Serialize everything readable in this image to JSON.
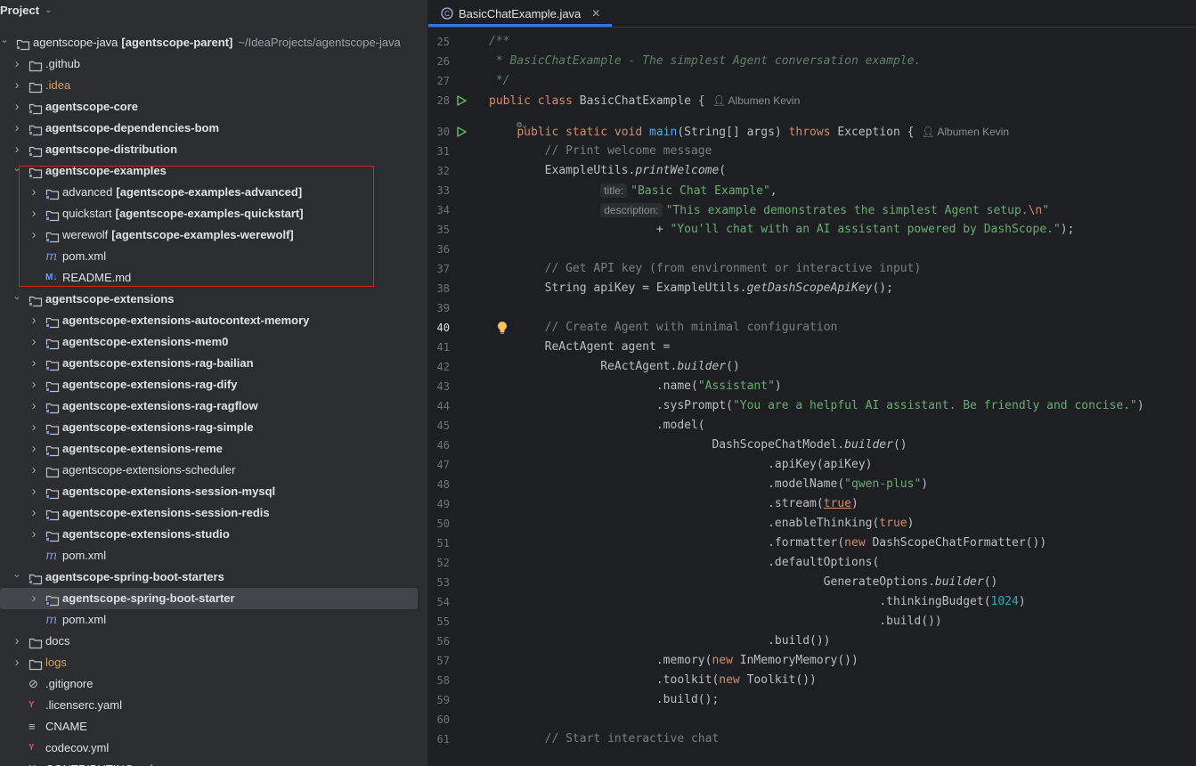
{
  "project_panel": {
    "title": "Project",
    "tree": [
      {
        "label": "agentscope-java",
        "suffix_bold": "[agentscope-parent]",
        "path": "~/IdeaProjects/agentscope-java",
        "icon": "module-folder-icon",
        "arrow": "expanded",
        "indent": 0
      },
      {
        "label": ".github",
        "icon": "folder-icon",
        "arrow": "collapsed",
        "indent": 1
      },
      {
        "label": ".idea",
        "icon": "folder-icon",
        "arrow": "collapsed",
        "indent": 1,
        "color": "orange"
      },
      {
        "label": "agentscope-core",
        "icon": "module-folder-icon",
        "arrow": "collapsed",
        "indent": 1,
        "bold": true
      },
      {
        "label": "agentscope-dependencies-bom",
        "icon": "module-folder-icon",
        "arrow": "collapsed",
        "indent": 1,
        "bold": true
      },
      {
        "label": "agentscope-distribution",
        "icon": "module-folder-icon",
        "arrow": "collapsed",
        "indent": 1,
        "bold": true
      },
      {
        "label": "agentscope-examples",
        "icon": "module-folder-icon",
        "arrow": "expanded",
        "indent": 1,
        "bold": true
      },
      {
        "label": "advanced",
        "suffix_bold": "[agentscope-examples-advanced]",
        "icon": "module-folder-icon",
        "arrow": "collapsed",
        "indent": 2
      },
      {
        "label": "quickstart",
        "suffix_bold": "[agentscope-examples-quickstart]",
        "icon": "module-folder-icon",
        "arrow": "collapsed",
        "indent": 2
      },
      {
        "label": "werewolf",
        "suffix_bold": "[agentscope-examples-werewolf]",
        "icon": "module-folder-icon",
        "arrow": "collapsed",
        "indent": 2
      },
      {
        "label": "pom.xml",
        "icon": "maven-icon",
        "arrow": "none",
        "indent": 2
      },
      {
        "label": "README.md",
        "icon": "markdown-icon",
        "arrow": "none",
        "indent": 2
      },
      {
        "label": "agentscope-extensions",
        "icon": "module-folder-icon",
        "arrow": "expanded",
        "indent": 1,
        "bold": true
      },
      {
        "label": "agentscope-extensions-autocontext-memory",
        "icon": "module-folder-icon",
        "arrow": "collapsed",
        "indent": 2,
        "bold": true
      },
      {
        "label": "agentscope-extensions-mem0",
        "icon": "module-folder-icon",
        "arrow": "collapsed",
        "indent": 2,
        "bold": true
      },
      {
        "label": "agentscope-extensions-rag-bailian",
        "icon": "module-folder-icon",
        "arrow": "collapsed",
        "indent": 2,
        "bold": true
      },
      {
        "label": "agentscope-extensions-rag-dify",
        "icon": "module-folder-icon",
        "arrow": "collapsed",
        "indent": 2,
        "bold": true
      },
      {
        "label": "agentscope-extensions-rag-ragflow",
        "icon": "module-folder-icon",
        "arrow": "collapsed",
        "indent": 2,
        "bold": true
      },
      {
        "label": "agentscope-extensions-rag-simple",
        "icon": "module-folder-icon",
        "arrow": "collapsed",
        "indent": 2,
        "bold": true
      },
      {
        "label": "agentscope-extensions-reme",
        "icon": "module-folder-icon",
        "arrow": "collapsed",
        "indent": 2,
        "bold": true
      },
      {
        "label": "agentscope-extensions-scheduler",
        "icon": "folder-icon",
        "arrow": "collapsed",
        "indent": 2
      },
      {
        "label": "agentscope-extensions-session-mysql",
        "icon": "module-folder-icon",
        "arrow": "collapsed",
        "indent": 2,
        "bold": true
      },
      {
        "label": "agentscope-extensions-session-redis",
        "icon": "module-folder-icon",
        "arrow": "collapsed",
        "indent": 2,
        "bold": true
      },
      {
        "label": "agentscope-extensions-studio",
        "icon": "module-folder-icon",
        "arrow": "collapsed",
        "indent": 2,
        "bold": true
      },
      {
        "label": "pom.xml",
        "icon": "maven-icon",
        "arrow": "none",
        "indent": 2
      },
      {
        "label": "agentscope-spring-boot-starters",
        "icon": "module-folder-icon",
        "arrow": "expanded",
        "indent": 1,
        "bold": true
      },
      {
        "label": "agentscope-spring-boot-starter",
        "icon": "module-folder-icon",
        "arrow": "collapsed",
        "indent": 2,
        "bold": true,
        "selected": true
      },
      {
        "label": "pom.xml",
        "icon": "maven-icon",
        "arrow": "none",
        "indent": 2
      },
      {
        "label": "docs",
        "icon": "folder-icon",
        "arrow": "collapsed",
        "indent": 1
      },
      {
        "label": "logs",
        "icon": "folder-icon",
        "arrow": "collapsed",
        "indent": 1,
        "color": "orange"
      },
      {
        "label": ".gitignore",
        "icon": "gitignore-icon",
        "arrow": "none",
        "indent": 1
      },
      {
        "label": ".licenserc.yaml",
        "icon": "yaml-icon",
        "arrow": "none",
        "indent": 1
      },
      {
        "label": "CNAME",
        "icon": "text-file-icon",
        "arrow": "none",
        "indent": 1
      },
      {
        "label": "codecov.yml",
        "icon": "yaml-icon",
        "arrow": "none",
        "indent": 1
      },
      {
        "label": "CONTRIBUTING.md",
        "icon": "markdown-icon",
        "arrow": "none",
        "indent": 1
      }
    ]
  },
  "editor": {
    "tab_label": "BasicChatExample.java",
    "tab_close": "✕",
    "author": "Albumen Kevin",
    "current_line": 40,
    "lines": [
      {
        "n": 25,
        "html": "<span class=\"c-doc\">/**</span>"
      },
      {
        "n": 26,
        "html": "<span class=\"c-doc\"> * BasicChatExample - The simplest Agent conversation example.</span>"
      },
      {
        "n": 27,
        "html": "<span class=\"c-doc\"> */</span>"
      },
      {
        "n": 28,
        "html": "<span class=\"c-kw\">public class </span>BasicChatExample {",
        "author": true,
        "run": true
      },
      {
        "n": 30,
        "html": "    <span class=\"c-kw\">public static void </span><span class=\"c-fn\">main</span>(String[] args) <span class=\"c-kw\">throws </span>Exception {",
        "author": true,
        "run": true
      },
      {
        "n": 31,
        "html": "        <span class=\"c-com\">// Print welcome message</span>"
      },
      {
        "n": 32,
        "html": "        ExampleUtils.<span class=\"c-it\">printWelcome</span>("
      },
      {
        "n": 33,
        "html": "                <span class=\"inlay\">title:</span><span class=\"c-str\">\"Basic Chat Example\"</span>,"
      },
      {
        "n": 34,
        "html": "                <span class=\"inlay\">description:</span><span class=\"c-str\">\"This example demonstrates the simplest Agent setup.</span><span class=\"c-esc\">\\n</span><span class=\"c-str\">\"</span>"
      },
      {
        "n": 35,
        "html": "                        + <span class=\"c-str\">\"You'll chat with an AI assistant powered by DashScope.\"</span>);"
      },
      {
        "n": 36,
        "html": ""
      },
      {
        "n": 37,
        "html": "        <span class=\"c-com\">// Get API key (from environment or interactive input)</span>"
      },
      {
        "n": 38,
        "html": "        String apiKey = ExampleUtils.<span class=\"c-it\">getDashScopeApiKey</span>();"
      },
      {
        "n": 39,
        "html": ""
      },
      {
        "n": 40,
        "html": "        <span class=\"c-com\">// Create Agent with minimal configuration</span>",
        "bulb": true
      },
      {
        "n": 41,
        "html": "        ReActAgent agent ="
      },
      {
        "n": 42,
        "html": "                ReActAgent.<span class=\"c-it\">builder</span>()"
      },
      {
        "n": 43,
        "html": "                        .name(<span class=\"c-str\">\"Assistant\"</span>)"
      },
      {
        "n": 44,
        "html": "                        .sysPrompt(<span class=\"c-str\">\"You are a helpful AI assistant. Be friendly and concise.\"</span>)"
      },
      {
        "n": 45,
        "html": "                        .model("
      },
      {
        "n": 46,
        "html": "                                DashScopeChatModel.<span class=\"c-it\">builder</span>()"
      },
      {
        "n": 47,
        "html": "                                        .apiKey(apiKey)"
      },
      {
        "n": 48,
        "html": "                                        .modelName(<span class=\"c-str\">\"qwen-plus\"</span>)"
      },
      {
        "n": 49,
        "html": "                                        .stream(<span class=\"c-kw c-under\">true</span>)"
      },
      {
        "n": 50,
        "html": "                                        .enableThinking(<span class=\"c-kw\">true</span>)"
      },
      {
        "n": 51,
        "html": "                                        .formatter(<span class=\"c-kw\">new </span>DashScopeChatFormatter())"
      },
      {
        "n": 52,
        "html": "                                        .defaultOptions("
      },
      {
        "n": 53,
        "html": "                                                GenerateOptions.<span class=\"c-it\">builder</span>()"
      },
      {
        "n": 54,
        "html": "                                                        .thinkingBudget(<span class=\"c-num\">1024</span>)"
      },
      {
        "n": 55,
        "html": "                                                        .build())"
      },
      {
        "n": 56,
        "html": "                                        .build())"
      },
      {
        "n": 57,
        "html": "                        .memory(<span class=\"c-kw\">new </span>InMemoryMemory())"
      },
      {
        "n": 58,
        "html": "                        .toolkit(<span class=\"c-kw\">new </span>Toolkit())"
      },
      {
        "n": 59,
        "html": "                        .build();"
      },
      {
        "n": 60,
        "html": ""
      },
      {
        "n": 61,
        "html": "        <span class=\"c-com\">// Start interactive chat</span>"
      }
    ]
  },
  "colors": {
    "accent": "#3574f0",
    "highlight_box": "#c62828",
    "run_green": "#5fb865",
    "bulb_yellow": "#f2c55c"
  }
}
